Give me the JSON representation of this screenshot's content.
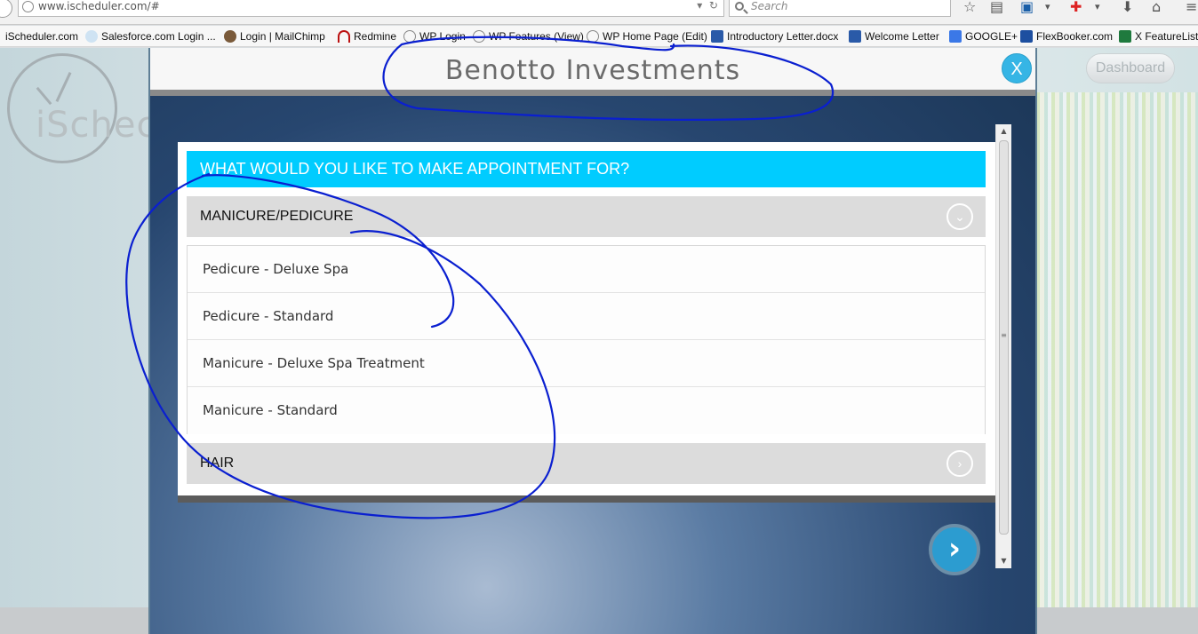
{
  "browser": {
    "url": "www.ischeduler.com/#",
    "search_placeholder": "Search",
    "bookmarks": [
      {
        "label": "iScheduler.com",
        "icon": "clock-icon"
      },
      {
        "label": "Salesforce.com Login ...",
        "icon": "cloud-icon"
      },
      {
        "label": "Login | MailChimp",
        "icon": "mailchimp-icon"
      },
      {
        "label": "Redmine",
        "icon": "redmine-icon"
      },
      {
        "label": "WP Login",
        "icon": "clock-icon"
      },
      {
        "label": "WP Features (View)",
        "icon": "clock-icon"
      },
      {
        "label": "WP Home Page (Edit)",
        "icon": "clock-icon"
      },
      {
        "label": "Introductory Letter.docx",
        "icon": "word-icon"
      },
      {
        "label": "Welcome Letter",
        "icon": "word-icon"
      },
      {
        "label": "GOOGLE+",
        "icon": "google-icon"
      },
      {
        "label": "FlexBooker.com",
        "icon": "flexbooker-icon"
      },
      {
        "label": "X FeatureList",
        "icon": "excel-icon"
      }
    ]
  },
  "background": {
    "logo_text": "iSchec",
    "dashboard_label": "Dashboard"
  },
  "modal": {
    "title": "Benotto Investments",
    "close_label": "X",
    "heading": "WHAT WOULD YOU LIKE TO MAKE APPOINTMENT FOR?",
    "categories": [
      {
        "label": "MANICURE/PEDICURE",
        "expanded": true
      },
      {
        "label": "HAIR",
        "expanded": false
      }
    ],
    "services": [
      "Pedicure - Deluxe Spa",
      "Pedicure - Standard",
      "Manicure - Deluxe Spa Treatment",
      "Manicure - Standard"
    ],
    "next_label": "›"
  },
  "colors": {
    "heading_bg": "#00ccff",
    "close_bg": "#36b5e5",
    "category_bg": "#dcdcdc",
    "annotation_ink": "#0a1fd0"
  }
}
